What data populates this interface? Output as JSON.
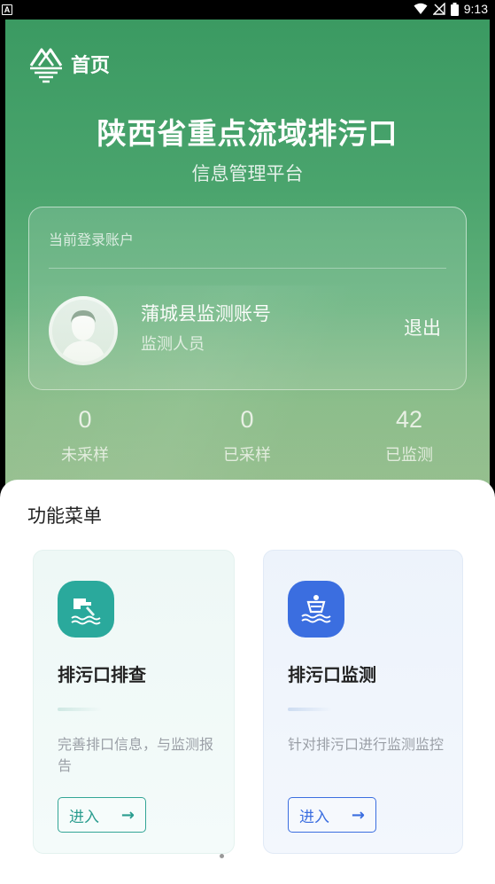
{
  "status_bar": {
    "time": "9:13",
    "notification_icon": "A"
  },
  "header": {
    "nav_title": "首页",
    "title": "陕西省重点流域排污口",
    "subtitle": "信息管理平台"
  },
  "account": {
    "label": "当前登录账户",
    "name": "蒲城县监测账号",
    "role": "监测人员",
    "logout_label": "退出"
  },
  "stats": [
    {
      "value": "0",
      "label": "未采样"
    },
    {
      "value": "0",
      "label": "已采样"
    },
    {
      "value": "42",
      "label": "已监测"
    }
  ],
  "menu": {
    "title": "功能菜单",
    "items": [
      {
        "title": "排污口排查",
        "desc": "完善排口信息，与监测报告",
        "button": "进入",
        "icon": "outfall-pipe-icon",
        "color": "#2aa99c"
      },
      {
        "title": "排污口监测",
        "desc": "针对排污口进行监测监控",
        "button": "进入",
        "icon": "buoy-monitor-icon",
        "color": "#3b6ee0"
      }
    ]
  }
}
